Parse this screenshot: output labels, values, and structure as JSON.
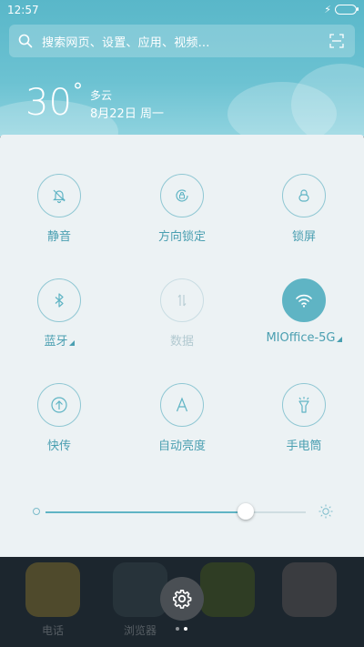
{
  "status_bar": {
    "time": "12:57"
  },
  "search": {
    "placeholder": "搜索网页、设置、应用、视频..."
  },
  "weather": {
    "temperature": "30",
    "degree_symbol": "°",
    "condition": "多云",
    "date": "8月22日 周一"
  },
  "toggles": [
    {
      "label": "静音",
      "icon": "mute-bell-icon",
      "active": false,
      "enabled": true
    },
    {
      "label": "方向锁定",
      "icon": "rotation-lock-icon",
      "active": false,
      "enabled": true
    },
    {
      "label": "锁屏",
      "icon": "lock-icon",
      "active": false,
      "enabled": true
    },
    {
      "label": "蓝牙",
      "icon": "bluetooth-icon",
      "active": false,
      "enabled": true,
      "has_menu": true
    },
    {
      "label": "数据",
      "icon": "mobile-data-icon",
      "active": false,
      "enabled": false
    },
    {
      "label": "MIOffice-5G",
      "icon": "wifi-icon",
      "active": true,
      "enabled": true,
      "has_menu": true
    },
    {
      "label": "快传",
      "icon": "quick-transfer-icon",
      "active": false,
      "enabled": true
    },
    {
      "label": "自动亮度",
      "icon": "auto-brightness-icon",
      "active": false,
      "enabled": true
    },
    {
      "label": "手电筒",
      "icon": "flashlight-icon",
      "active": false,
      "enabled": true
    }
  ],
  "brightness": {
    "level": 0.77
  },
  "home": {
    "apps": [
      {
        "label": "电话"
      },
      {
        "label": "浏览器"
      },
      {
        "label": ""
      },
      {
        "label": ""
      }
    ]
  },
  "colors": {
    "accent": "#5fb4c4",
    "panel": "#ecf2f4",
    "sky": "#6cc2d2"
  }
}
